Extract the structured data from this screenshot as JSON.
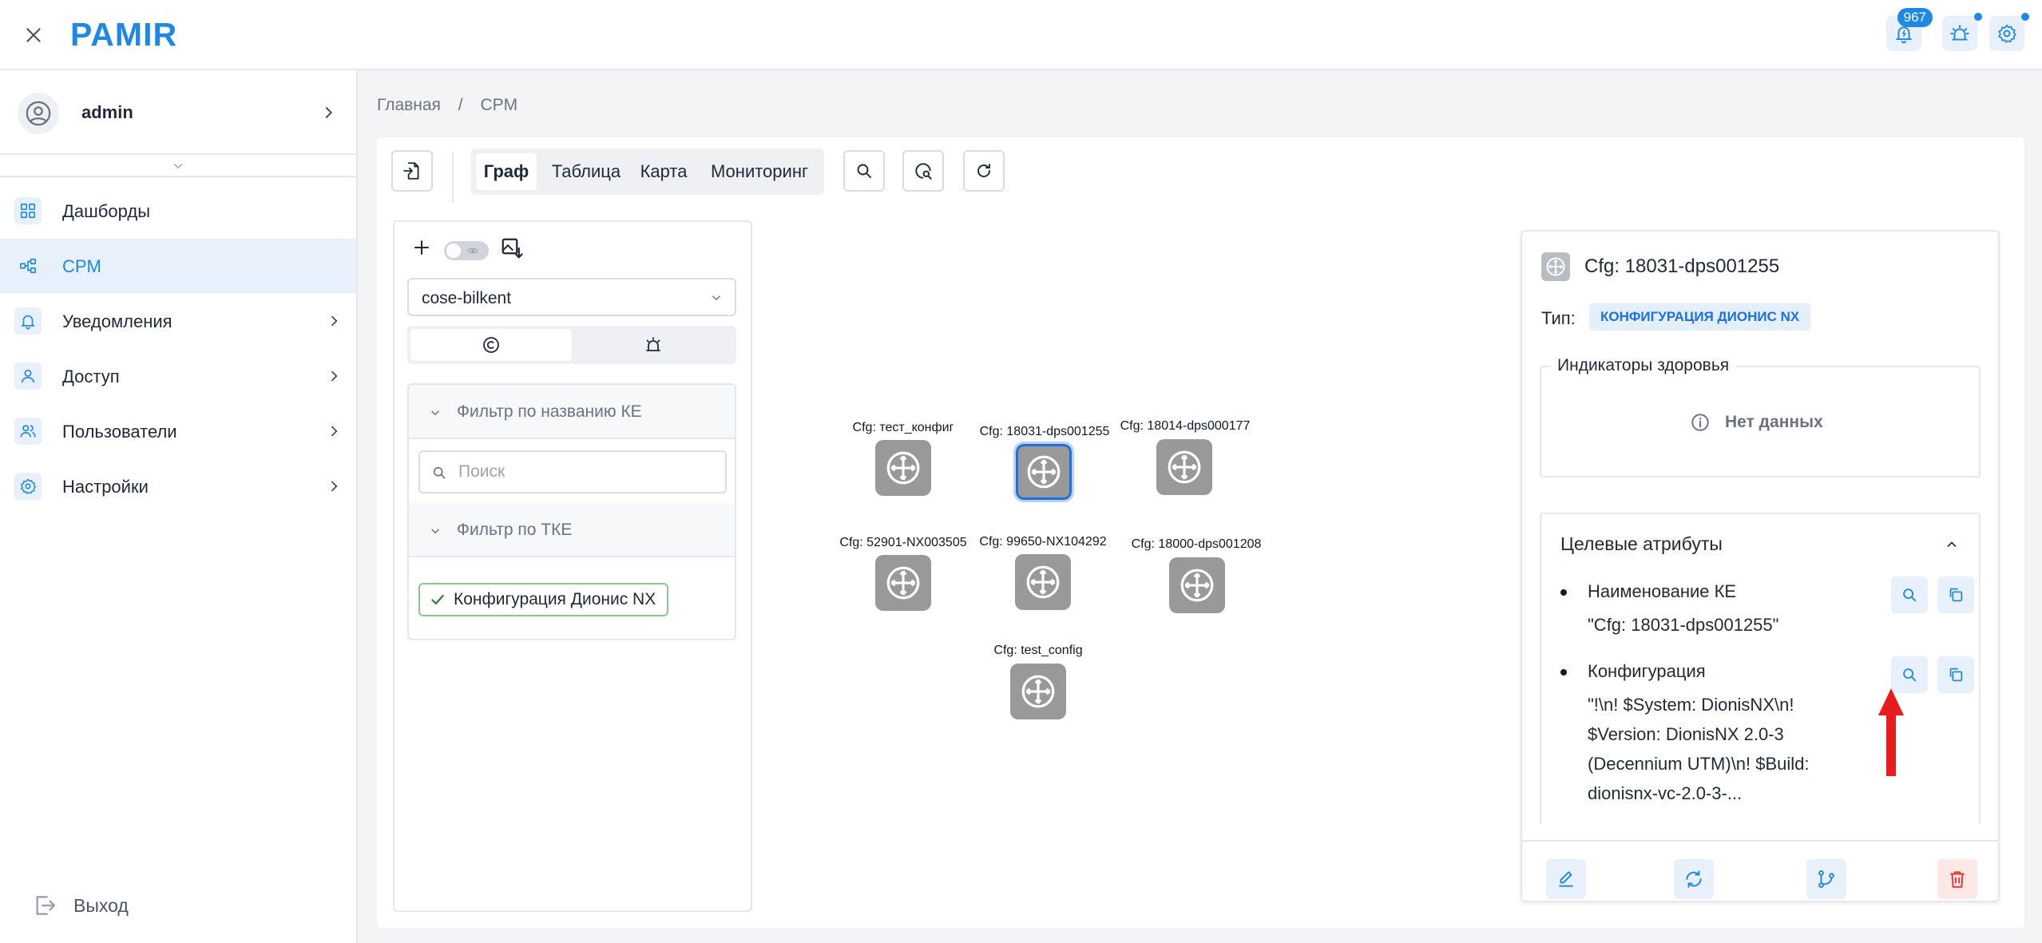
{
  "app": {
    "title": "PAMIR",
    "notification_count": "967"
  },
  "user": {
    "name": "admin"
  },
  "sidebar": {
    "items": [
      {
        "label": "Дашборды",
        "icon": "dashboard-icon",
        "active": false,
        "has_children": false
      },
      {
        "label": "CPM",
        "icon": "graph-icon",
        "active": true,
        "has_children": false
      },
      {
        "label": "Уведомления",
        "icon": "bell-icon",
        "active": false,
        "has_children": true
      },
      {
        "label": "Доступ",
        "icon": "user-icon",
        "active": false,
        "has_children": true
      },
      {
        "label": "Пользователи",
        "icon": "users-icon",
        "active": false,
        "has_children": true
      },
      {
        "label": "Настройки",
        "icon": "gear-icon",
        "active": false,
        "has_children": true
      }
    ],
    "logout_label": "Выход"
  },
  "breadcrumb": {
    "home": "Главная",
    "separator": "/",
    "current": "CPM"
  },
  "toolbar": {
    "tabs": [
      {
        "label": "Граф",
        "active": true
      },
      {
        "label": "Таблица",
        "active": false
      },
      {
        "label": "Карта",
        "active": false
      },
      {
        "label": "Мониторинг",
        "active": false
      }
    ]
  },
  "filter_panel": {
    "layout_select": "cose-bilkent",
    "name_filter_label": "Фильтр по названию КЕ",
    "search_placeholder": "Поиск",
    "tke_filter_label": "Фильтр по ТКЕ",
    "selected_type_chip": "Конфигурация Дионис NX"
  },
  "graph": {
    "nodes": [
      {
        "label": "Cfg: тест_конфиг",
        "selected": false
      },
      {
        "label": "Cfg: 18031-dps001255",
        "selected": true
      },
      {
        "label": "Cfg: 18014-dps000177",
        "selected": false
      },
      {
        "label": "Cfg: 52901-NX003505",
        "selected": false
      },
      {
        "label": "Cfg: 99650-NX104292",
        "selected": false
      },
      {
        "label": "Cfg: 18000-dps001208",
        "selected": false
      },
      {
        "label": "Cfg: test_config",
        "selected": false
      }
    ]
  },
  "details": {
    "title": "Cfg: 18031-dps001255",
    "type_label": "Тип:",
    "type_value": "КОНФИГУРАЦИЯ ДИОНИС NX",
    "health_title": "Индикаторы здоровья",
    "health_empty": "Нет данных",
    "attrs_title": "Целевые атрибуты",
    "attributes": [
      {
        "name": "Наименование КЕ",
        "value": "\"Cfg: 18031-dps001255\""
      },
      {
        "name": "Конфигурация",
        "value": "\"!\\n! $System: DionisNX\\n! $Version: DionisNX 2.0-3 (Decennium UTM)\\n! $Build: dionisnx-vc-2.0-3-..."
      }
    ]
  },
  "colors": {
    "accent": "#1e88e5",
    "node": "#999999",
    "danger": "#e53935",
    "annotation_arrow": "#e81c1c"
  }
}
